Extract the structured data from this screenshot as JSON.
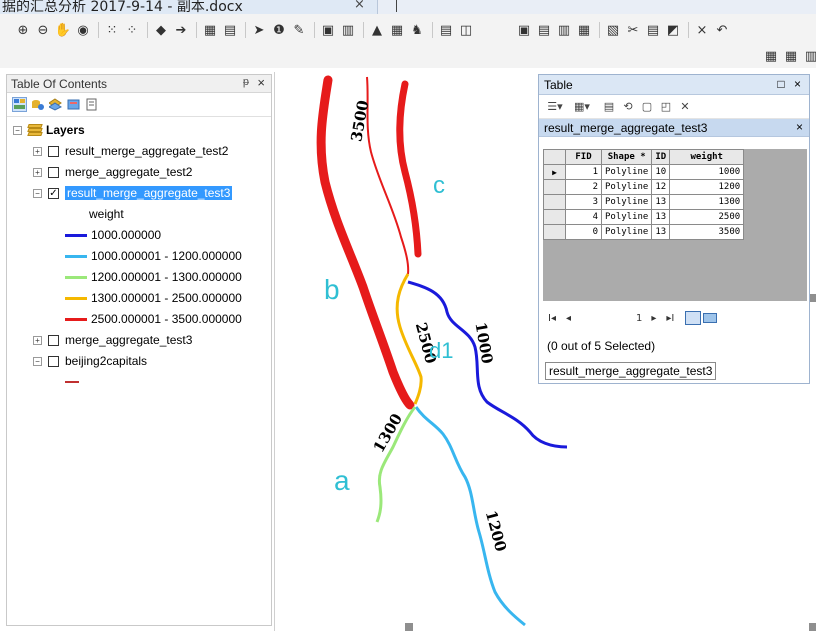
{
  "window": {
    "doc_tab": "据的汇总分析 2017-9-14 - 副本.docx",
    "close_glyph": "×"
  },
  "toolbar": {
    "row1": [
      "⊕",
      "⊖",
      "✋",
      "◉",
      "⁙",
      "⁘",
      "◆",
      "➔",
      "▦",
      "▤",
      "➤",
      "❶",
      "✎",
      "▣",
      "▥",
      "▲",
      "▦",
      "♞",
      "▤",
      "◫",
      "▣",
      "▤",
      "▥",
      "▦",
      "▧",
      "✂",
      "▤",
      "◩",
      "×",
      "↶"
    ],
    "row2": [
      "▦",
      "▦",
      "▥",
      "▤"
    ]
  },
  "toc": {
    "title": "Table Of Contents",
    "pin": "ᵽ",
    "close": "×",
    "root_label": "Layers",
    "layers": [
      {
        "name": "result_merge_aggregate_test2",
        "checked": false,
        "expanded": false
      },
      {
        "name": "merge_aggregate_test2",
        "checked": false,
        "expanded": false
      },
      {
        "name": "result_merge_aggregate_test3",
        "checked": true,
        "expanded": true,
        "selected": true
      },
      {
        "name": "merge_aggregate_test3",
        "checked": false,
        "expanded": false
      },
      {
        "name": "beijing2capitals",
        "checked": false,
        "expanded": true
      }
    ],
    "field_label": "weight",
    "classes": [
      {
        "label": "1000.000000",
        "color": "#1a1adb"
      },
      {
        "label": "1000.000001 - 1200.000000",
        "color": "#38b6ef"
      },
      {
        "label": "1200.000001 - 1300.000000",
        "color": "#9be87a"
      },
      {
        "label": "1300.000001 - 2500.000000",
        "color": "#f5b800"
      },
      {
        "label": "2500.000001 - 3500.000000",
        "color": "#e61b1b"
      }
    ],
    "beijing_symbol_color": "#c03030"
  },
  "table_window": {
    "title": "Table",
    "controls": "□ ×",
    "tab_label": "result_merge_aggregate_test3",
    "tab_close": "×",
    "columns": [
      "FID",
      "Shape *",
      "ID",
      "weight"
    ],
    "rows": [
      {
        "fid": "1",
        "shape": "Polyline",
        "id": "10",
        "weight": "1000",
        "current": true
      },
      {
        "fid": "2",
        "shape": "Polyline",
        "id": "12",
        "weight": "1200",
        "current": false
      },
      {
        "fid": "3",
        "shape": "Polyline",
        "id": "13",
        "weight": "1300",
        "current": false
      },
      {
        "fid": "4",
        "shape": "Polyline",
        "id": "13",
        "weight": "2500",
        "current": false
      },
      {
        "fid": "0",
        "shape": "Polyline",
        "id": "13",
        "weight": "3500",
        "current": false
      }
    ],
    "nav": {
      "first": "I◂",
      "prev": "◂",
      "page": "1",
      "next": "▸",
      "last": "▸I"
    },
    "status": "(0 out of 5 Selected)",
    "bottom_tab": "result_merge_aggregate_test3"
  },
  "map": {
    "labels": {
      "a": "a",
      "b": "b",
      "c": "c",
      "d": "d1"
    },
    "line_labels": {
      "w3500": "3500",
      "w2500": "2500",
      "w1000": "1000",
      "w1300": "1300",
      "w1200": "1200"
    },
    "colors": {
      "w1000": "#1a1adb",
      "w1200": "#38b6ef",
      "w1300": "#9be87a",
      "w2500": "#f5b800",
      "w3500": "#e61b1b",
      "annotation": "#2fbfd3"
    }
  }
}
